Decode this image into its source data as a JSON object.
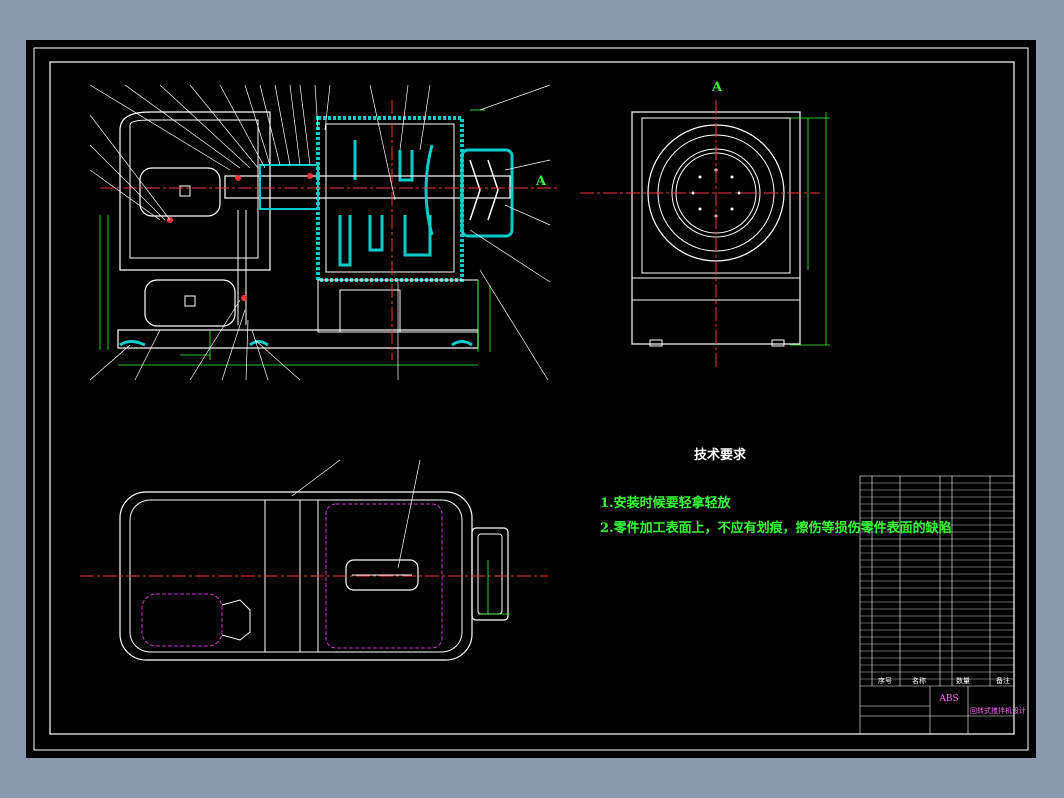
{
  "drawing": {
    "tech_title": "技术要求",
    "requirements": [
      "1.安装时候要轻拿轻放",
      "2.零件加工表面上，不应有划痕，擦伤等损伤零件表面的缺陷"
    ],
    "section_label": "A",
    "section_arrow_label": "A"
  },
  "title_block": {
    "logo": "ABS",
    "drawing_name": "回转式搅拌机设计",
    "header_cells": [
      "序号",
      "名称",
      "数量",
      "备注"
    ]
  },
  "colors": {
    "background": "#8a99ad",
    "sheet": "#000000",
    "frame": "#ffffff",
    "centerline": "#ff3333",
    "dimension": "#33ff33",
    "hatch": "#00cccc",
    "hidden": "#cc33cc"
  }
}
